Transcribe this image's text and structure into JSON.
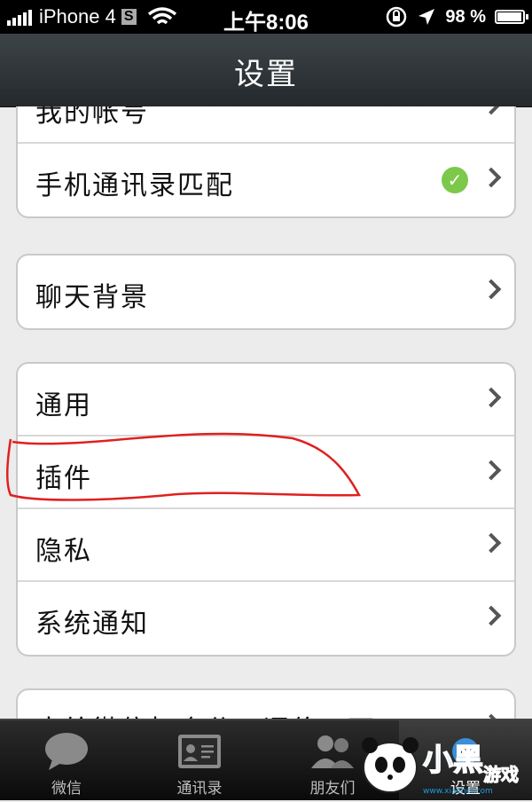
{
  "status_bar": {
    "carrier": "iPhone 4",
    "carrier_badge": "S",
    "time": "上午8:06",
    "battery": "98 %",
    "battery_level": 0.98
  },
  "nav": {
    "title": "设置"
  },
  "groups": {
    "account": [
      {
        "label": "我的帐号"
      },
      {
        "label": "手机通讯录匹配"
      }
    ],
    "chat": [
      {
        "label": "聊天背景"
      }
    ],
    "general": [
      {
        "label": "通用"
      },
      {
        "label": "插件"
      },
      {
        "label": "隐私"
      },
      {
        "label": "系统通知"
      }
    ],
    "partial": [
      {
        "label": "去给微信打个分，评价一下"
      }
    ]
  },
  "tabs": [
    {
      "label": "微信"
    },
    {
      "label": "通讯录"
    },
    {
      "label": "朋友们"
    },
    {
      "label": "设置"
    }
  ],
  "watermark": {
    "brand": "小黑游戏",
    "url": "www.xiaohei.com"
  },
  "colors": {
    "nav_bg": "#2f3538",
    "check_green": "#7cc84b",
    "annotation_red": "#e02020"
  }
}
